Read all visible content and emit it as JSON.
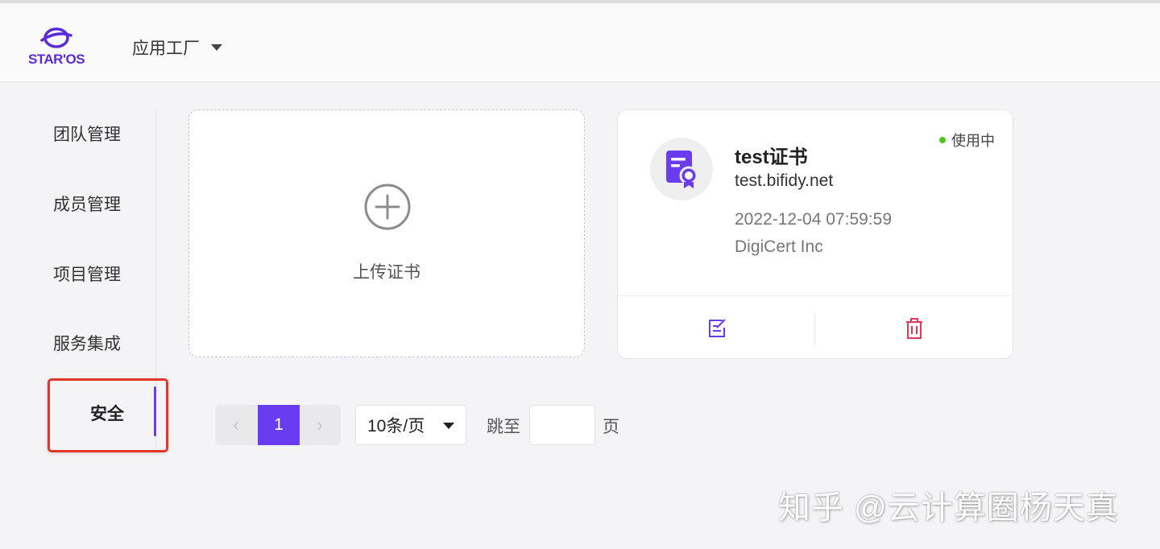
{
  "header": {
    "logo_text": "STAR'OS",
    "app_switch_label": "应用工厂"
  },
  "sidebar": {
    "items": [
      {
        "label": "团队管理"
      },
      {
        "label": "成员管理"
      },
      {
        "label": "项目管理"
      },
      {
        "label": "服务集成"
      },
      {
        "label": "安全",
        "active": true
      }
    ]
  },
  "upload": {
    "label": "上传证书"
  },
  "certificate": {
    "name": "test证书",
    "domain": "test.bifidy.net",
    "expires": "2022-12-04 07:59:59",
    "issuer": "DigiCert Inc",
    "status": "使用中",
    "status_color": "#52c41a"
  },
  "pagination": {
    "prev": "‹",
    "current_page": "1",
    "next": "›",
    "page_size": "10条/页",
    "jump_label": "跳至",
    "jump_value": "",
    "page_unit": "页"
  },
  "watermark": "知乎 @云计算圈杨天真",
  "colors": {
    "accent": "#6a3cf0",
    "danger": "#e0385a",
    "highlight": "#e2362b"
  }
}
